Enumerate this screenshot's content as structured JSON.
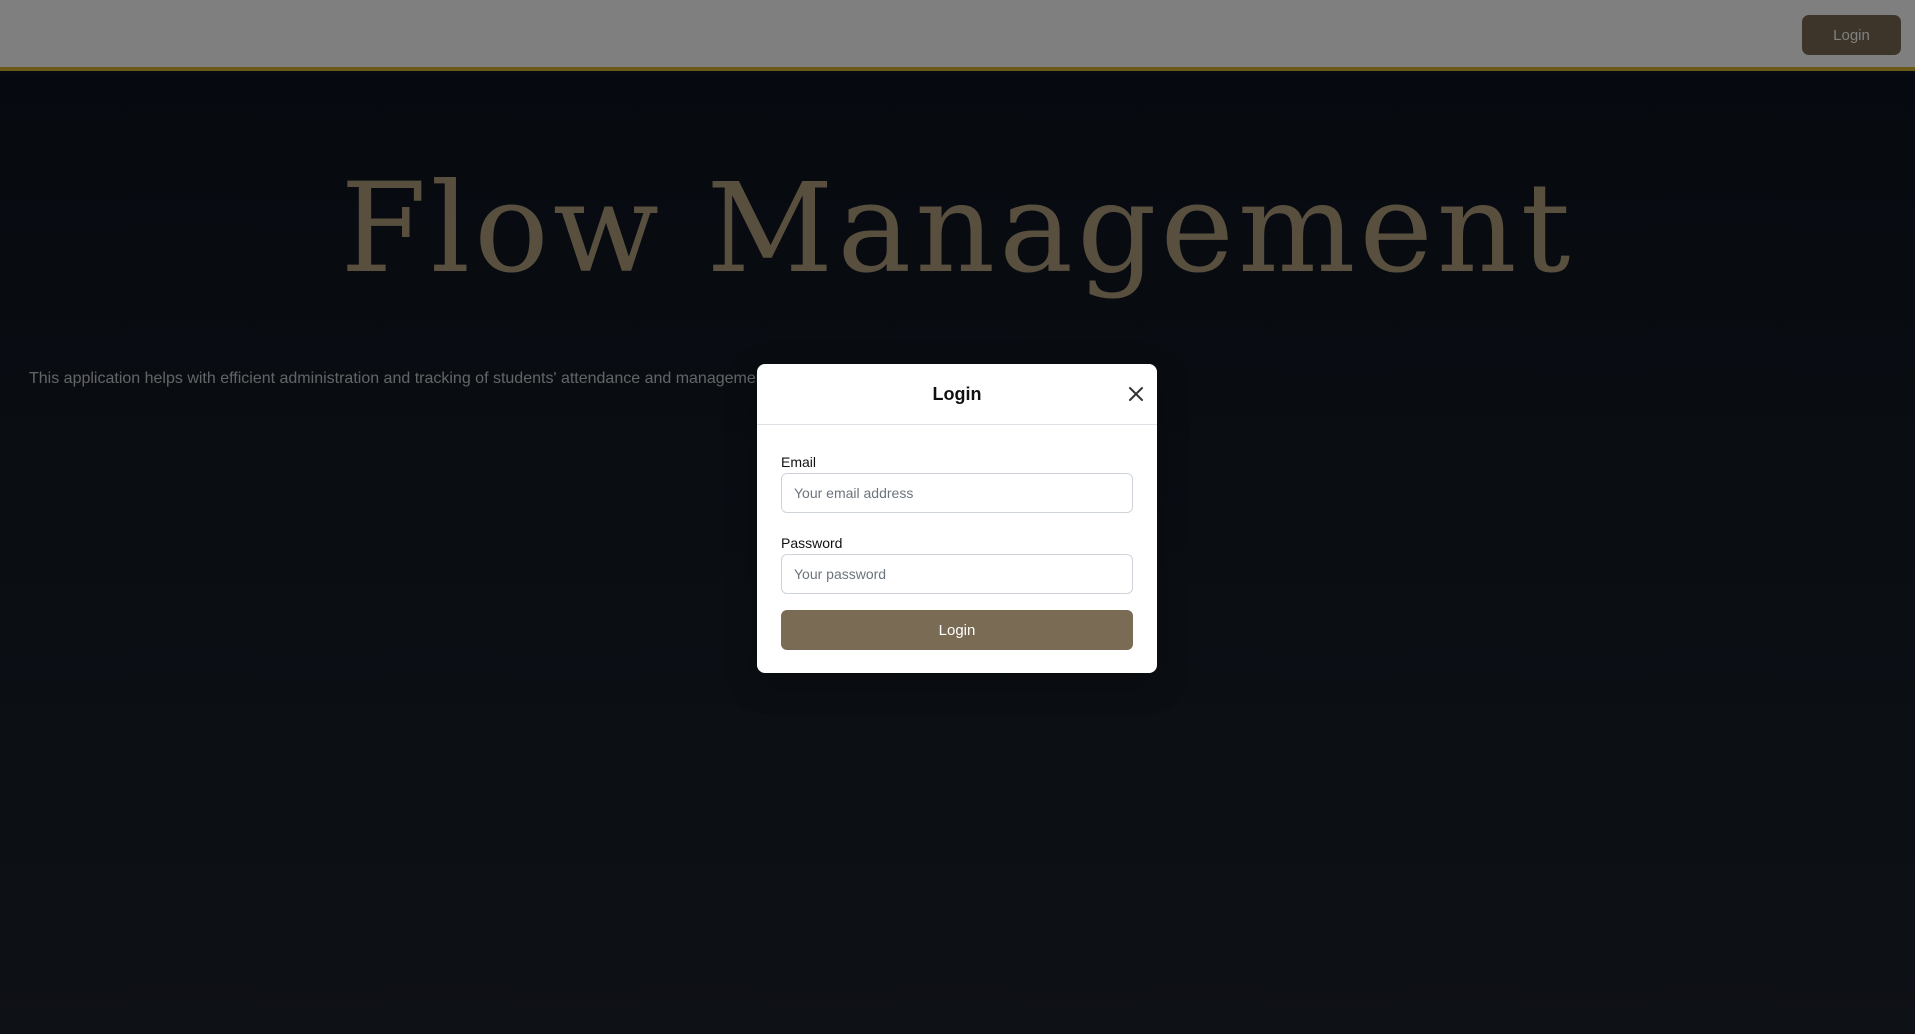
{
  "navbar": {
    "login_label": "Login"
  },
  "hero": {
    "title": "Flow Management",
    "description": "This application helps with efficient administration and tracking of students' attendance and management."
  },
  "modal": {
    "title": "Login",
    "email_label": "Email",
    "email_placeholder": "Your email address",
    "email_value": "",
    "password_label": "Password",
    "password_placeholder": "Your password",
    "password_value": "",
    "submit_label": "Login"
  },
  "icons": {
    "close": "close-icon"
  },
  "colors": {
    "accent": "#7a6b54",
    "navbar_border": "#d8b432",
    "hero_title": "#b19f7d"
  }
}
